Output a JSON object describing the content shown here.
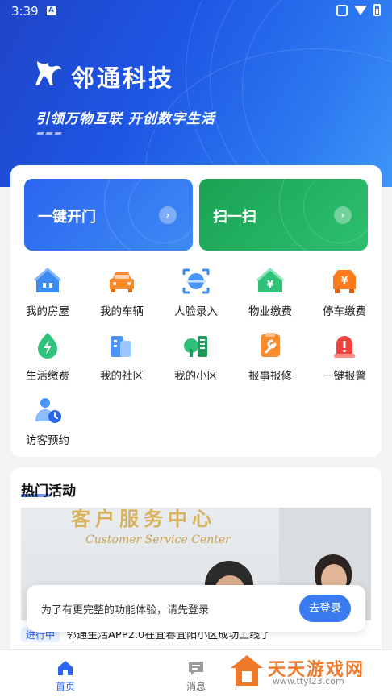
{
  "status_bar": {
    "time": "3:39",
    "notification_icon": "A"
  },
  "header": {
    "brand_name": "邻通科技",
    "slogan": "引领万物互联 开创数字生活"
  },
  "quick_actions": [
    {
      "label": "一键开门",
      "icon": "chevron-right-icon",
      "color": "#2a66ef"
    },
    {
      "label": "扫一扫",
      "icon": "chevron-right-icon",
      "color": "#1aa253"
    }
  ],
  "services": [
    {
      "label": "我的房屋",
      "icon": "house-icon"
    },
    {
      "label": "我的车辆",
      "icon": "car-icon"
    },
    {
      "label": "人脸录入",
      "icon": "face-scan-icon"
    },
    {
      "label": "物业缴费",
      "icon": "property-fee-icon"
    },
    {
      "label": "停车缴费",
      "icon": "parking-fee-icon"
    },
    {
      "label": "生活缴费",
      "icon": "utility-fee-icon"
    },
    {
      "label": "我的社区",
      "icon": "community-icon"
    },
    {
      "label": "我的小区",
      "icon": "neighborhood-icon"
    },
    {
      "label": "报事报修",
      "icon": "repair-icon"
    },
    {
      "label": "一键报警",
      "icon": "alarm-icon"
    },
    {
      "label": "访客预约",
      "icon": "visitor-icon"
    }
  ],
  "activities": {
    "title": "热门活动",
    "photo_sign_cn": "客户服务中心",
    "photo_sign_en": "Customer Service Center",
    "news_tag": "进行中",
    "news_text": "邻通生活APP2.0在宜春宜阳小区成功上线了"
  },
  "login_prompt": {
    "message": "为了有更完整的功能体验，请先登录",
    "button": "去登录"
  },
  "tabs": [
    {
      "label": "首页",
      "icon": "home-icon",
      "active": true
    },
    {
      "label": "消息",
      "icon": "message-icon",
      "active": false
    }
  ],
  "watermark": {
    "name": "天天游戏网",
    "url": "www.ttyl23.com"
  },
  "colors": {
    "primary": "#2a66ef",
    "green": "#1aa253"
  }
}
